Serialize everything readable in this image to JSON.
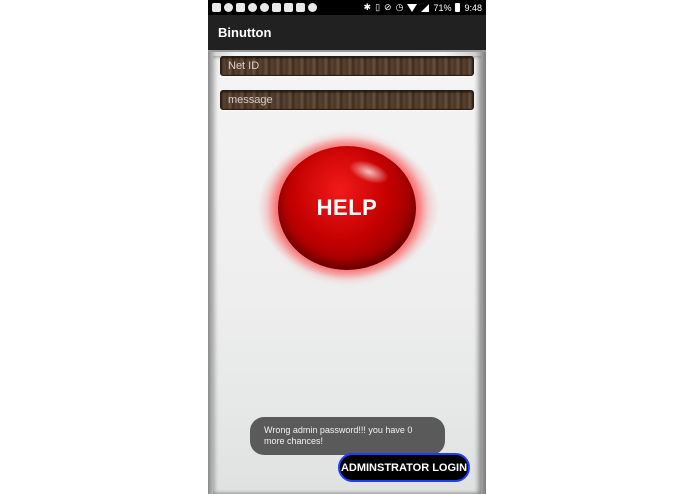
{
  "status_bar": {
    "time": "9:48",
    "battery": "71%",
    "notifications": [
      "calendar-icon",
      "skype-icon",
      "gallery-icon",
      "chat-icon",
      "chat-icon",
      "image-icon",
      "crop-icon",
      "tools-icon",
      "more-icon"
    ],
    "system_icons": [
      "bluetooth-icon",
      "vibrate-icon",
      "mute-icon",
      "alarm-icon",
      "wifi-icon",
      "cell-signal-icon",
      "battery-icon"
    ]
  },
  "app_bar": {
    "title": "Binutton"
  },
  "form": {
    "net_id_placeholder": "Net ID",
    "message_placeholder": "message"
  },
  "help_button": {
    "label": "HELP",
    "color": "#d00000"
  },
  "toast": {
    "text": "Wrong admin password!!! you have 0 more chances!"
  },
  "admin_button": {
    "label": "ADMINSTRATOR LOGIN",
    "border_color": "#1a3dff"
  }
}
